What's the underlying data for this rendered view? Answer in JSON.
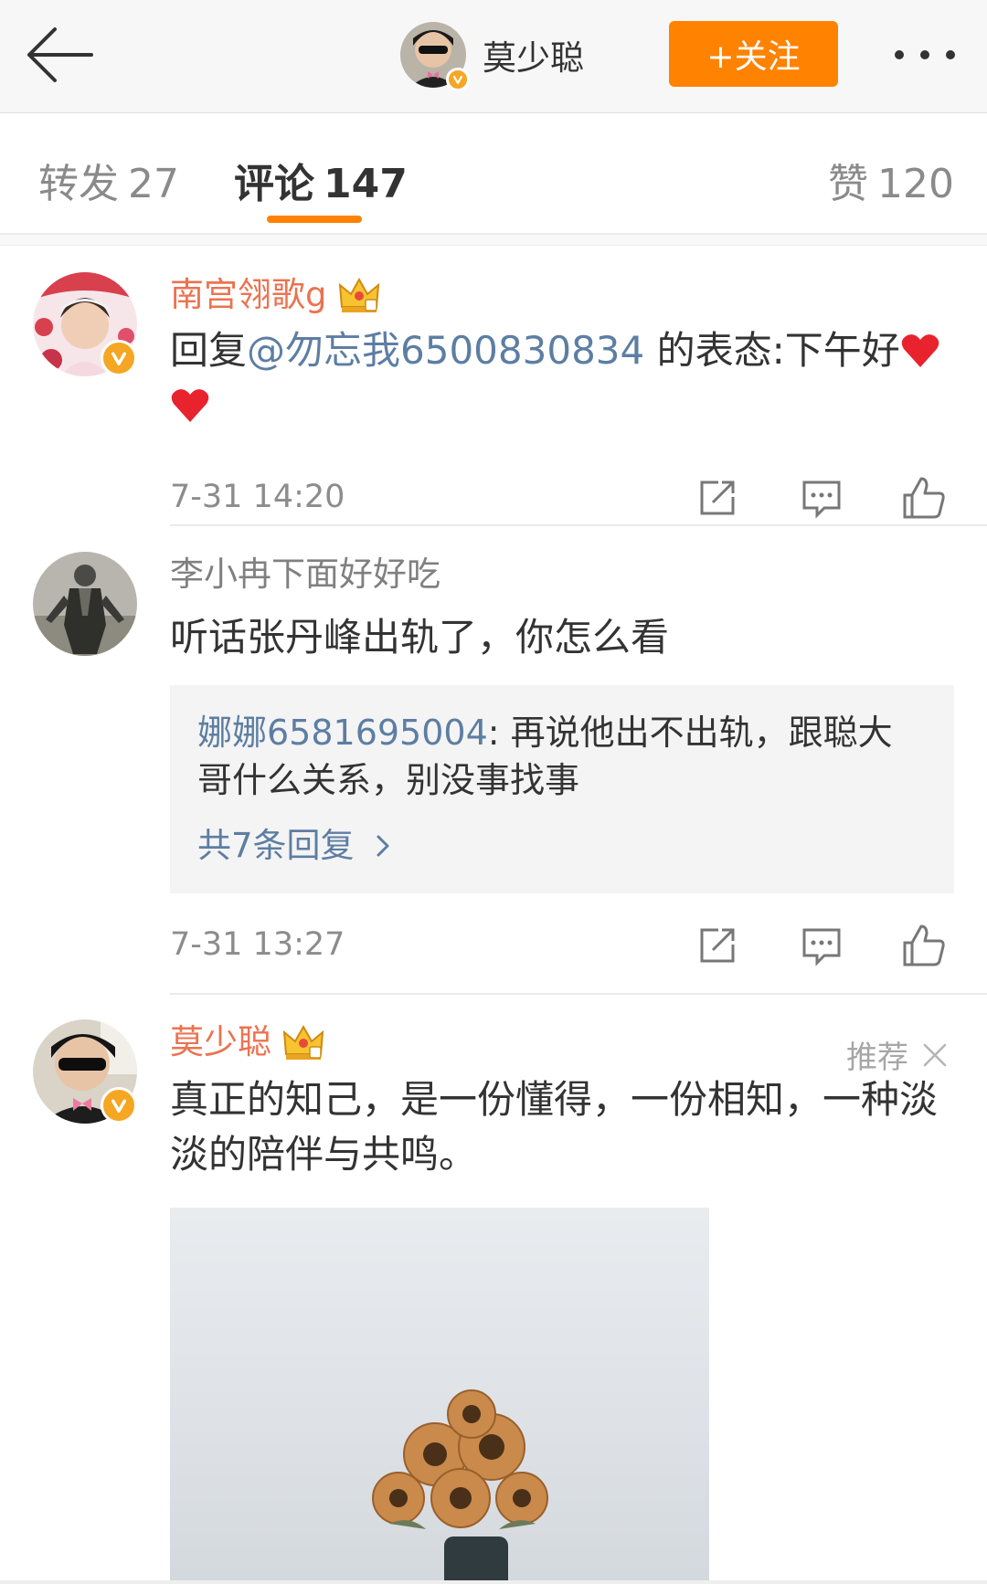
{
  "topbar": {
    "author_name": "莫少聪",
    "follow_label": "+关注"
  },
  "tabs": [
    {
      "label": "转发",
      "count": "27"
    },
    {
      "label": "评论",
      "count": "147"
    },
    {
      "label": "赞",
      "count": "120"
    }
  ],
  "comments": [
    {
      "user": "南宫翎歌g",
      "text_prefix": "回复",
      "mention": "@勿忘我6500830834",
      "text_suffix": " 的表态:下午好",
      "time": "7-31 14:20"
    },
    {
      "user": "李小冉下面好好吃",
      "text": "听话张丹峰出轨了，你怎么看",
      "reply_user": "娜娜6581695004",
      "reply_text": ": 再说他出不出轨，跟聪大哥什么关系，别没事找事",
      "reply_more": "共7条回复",
      "time": "7-31 13:27"
    },
    {
      "user": "莫少聪",
      "recommend_label": "推荐",
      "text": "真正的知己，是一份懂得，一份相知，一种淡淡的陪伴与共鸣。"
    }
  ],
  "colors": {
    "accent": "#ff8200",
    "vip_name": "#eb7350",
    "link": "#5d7ea3",
    "verified": "#f5a623",
    "heart": "#e8232d"
  }
}
